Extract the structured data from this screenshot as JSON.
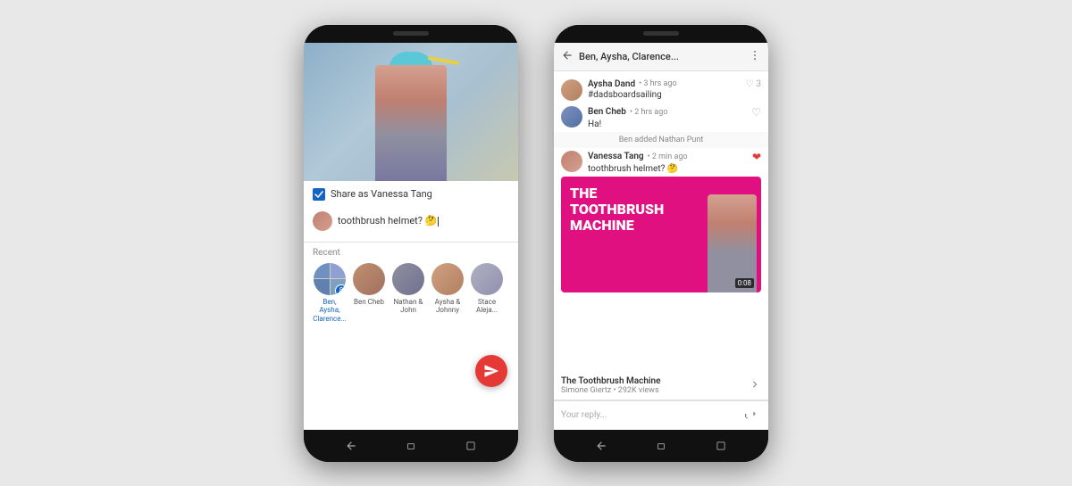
{
  "page": {
    "background": "#e8e8e8"
  },
  "phone1": {
    "share_label": "Share as Vanessa Tang",
    "message_text": "toothbrush helmet? 🤔",
    "recent_label": "Recent",
    "contacts": [
      {
        "name": "Ben, Aysha, Clarence...",
        "badge": "8",
        "color_class": "multi"
      },
      {
        "name": "Ben Cheb",
        "color_class": "ca2"
      },
      {
        "name": "Nathan & John",
        "color_class": "ca3"
      },
      {
        "name": "Aysha & Johnny",
        "color_class": "ca4"
      },
      {
        "name": "Stace Aleja...",
        "color_class": "ca5"
      }
    ],
    "nav": [
      "back",
      "home",
      "recent"
    ]
  },
  "phone2": {
    "header_title": "Ben, Aysha, Clarence...",
    "messages": [
      {
        "sender": "Aysha Dand",
        "time": "3 hrs ago",
        "likes": "♡ 3",
        "content": "#dadsboardsailing",
        "avatar_class": "chat-avatar-a"
      },
      {
        "sender": "Ben Cheb",
        "time": "2 hrs ago",
        "likes": "♡",
        "content": "Ha!",
        "avatar_class": "chat-avatar-b"
      },
      {
        "system": "Ben added Nathan Punt"
      },
      {
        "sender": "Vanessa Tang",
        "time": "2 min ago",
        "likes": "❤",
        "content": "toothbrush helmet? 🤔",
        "avatar_class": "chat-avatar-v"
      }
    ],
    "video": {
      "title_line1": "THE",
      "title_line2": "TOOTHBRUSH",
      "title_line3": "MACHINE",
      "duration": "0:08",
      "video_title": "The Toothbrush Machine",
      "channel": "Simone Giertz • 292K views"
    },
    "reply_placeholder": "Your reply...",
    "nav": [
      "back",
      "home",
      "recent"
    ]
  }
}
